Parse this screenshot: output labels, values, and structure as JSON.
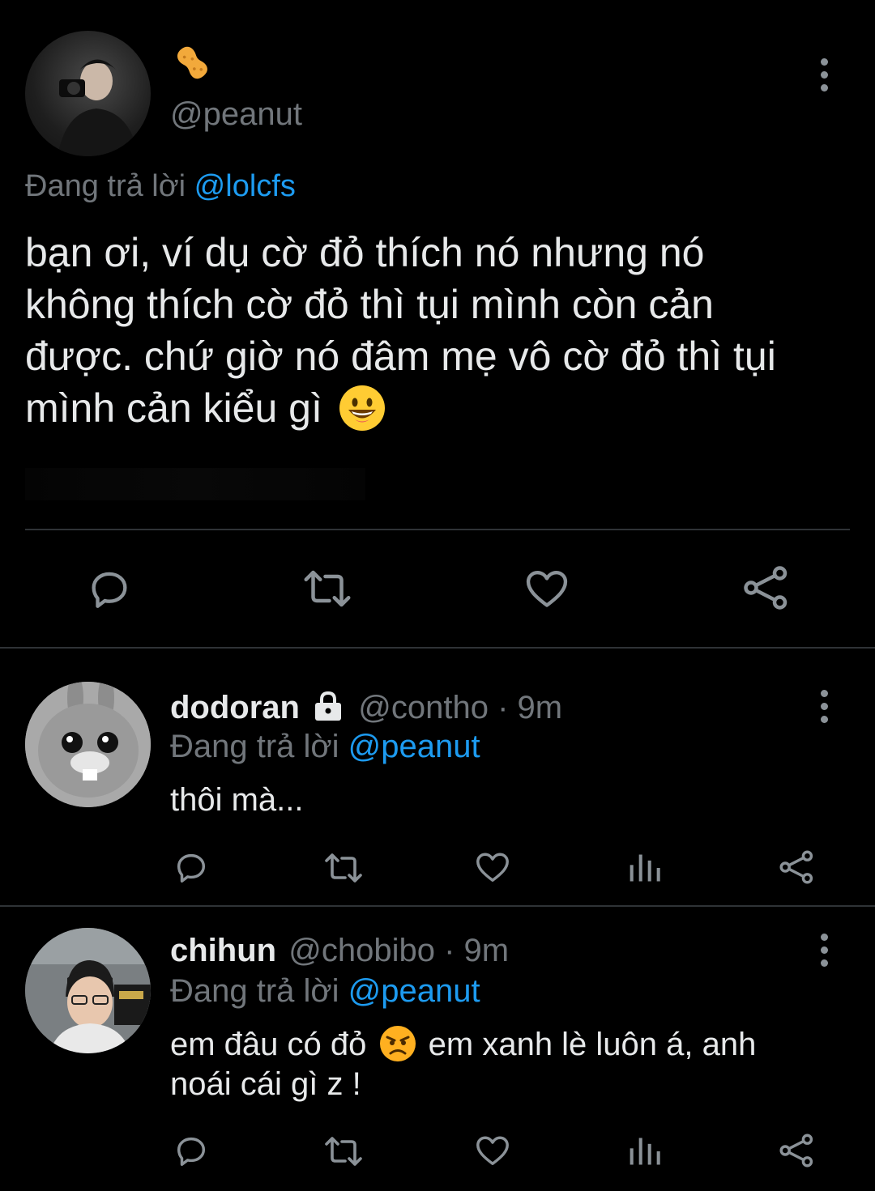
{
  "main_tweet": {
    "display_name_emoji": "🥜",
    "handle": "@peanut",
    "replying_prefix": "Đang trả lời",
    "replying_to": "@lolcfs",
    "text_line1": "bạn ơi, ví dụ cờ đỏ thích nó nhưng nó",
    "text_line2": "không thích cờ đỏ thì tụi mình còn cản",
    "text_line3": "được. chứ giờ nó đâm mẹ vô cờ đỏ thì tụi",
    "text_line4": "mình cản kiểu gì",
    "text_emoji": "😀",
    "actions": [
      "reply-icon",
      "retweet-icon",
      "like-icon",
      "share-icon"
    ]
  },
  "replies": [
    {
      "display_name": "dodoran",
      "locked": true,
      "handle": "@contho",
      "time": "· 9m",
      "replying_prefix": "Đang trả lời",
      "replying_to": "@peanut",
      "text": "thôi mà...",
      "actions": [
        "reply-icon",
        "retweet-icon",
        "like-icon",
        "analytics-icon",
        "share-icon"
      ]
    },
    {
      "display_name": "chihun",
      "handle": "@chobibo",
      "time": "· 9m",
      "replying_prefix": "Đang trả lời",
      "replying_to": "@peanut",
      "text_part1": "em đâu có đỏ",
      "text_emoji": "😠",
      "text_part2": "em xanh lè luôn á, anh",
      "text_line2": "noái cái gì z !",
      "actions": [
        "reply-icon",
        "retweet-icon",
        "like-icon",
        "analytics-icon",
        "share-icon"
      ]
    }
  ],
  "colors": {
    "background": "#000000",
    "text": "#e7e9ea",
    "muted": "#71767b",
    "link": "#1d9bf0",
    "divider": "#2f3336"
  }
}
